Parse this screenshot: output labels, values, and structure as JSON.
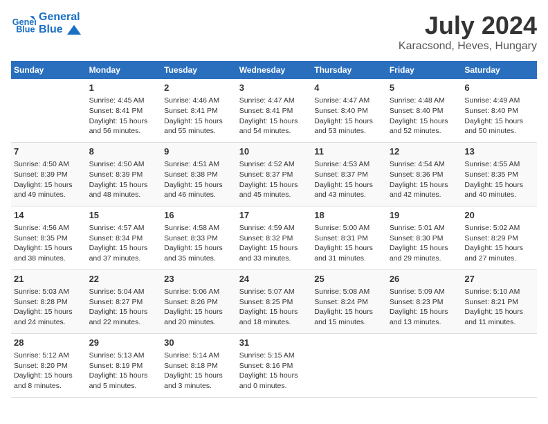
{
  "logo": {
    "line1": "General",
    "line2": "Blue"
  },
  "title": "July 2024",
  "subtitle": "Karacsond, Heves, Hungary",
  "headers": [
    "Sunday",
    "Monday",
    "Tuesday",
    "Wednesday",
    "Thursday",
    "Friday",
    "Saturday"
  ],
  "weeks": [
    [
      {
        "day": "",
        "content": ""
      },
      {
        "day": "1",
        "content": "Sunrise: 4:45 AM\nSunset: 8:41 PM\nDaylight: 15 hours\nand 56 minutes."
      },
      {
        "day": "2",
        "content": "Sunrise: 4:46 AM\nSunset: 8:41 PM\nDaylight: 15 hours\nand 55 minutes."
      },
      {
        "day": "3",
        "content": "Sunrise: 4:47 AM\nSunset: 8:41 PM\nDaylight: 15 hours\nand 54 minutes."
      },
      {
        "day": "4",
        "content": "Sunrise: 4:47 AM\nSunset: 8:40 PM\nDaylight: 15 hours\nand 53 minutes."
      },
      {
        "day": "5",
        "content": "Sunrise: 4:48 AM\nSunset: 8:40 PM\nDaylight: 15 hours\nand 52 minutes."
      },
      {
        "day": "6",
        "content": "Sunrise: 4:49 AM\nSunset: 8:40 PM\nDaylight: 15 hours\nand 50 minutes."
      }
    ],
    [
      {
        "day": "7",
        "content": "Sunrise: 4:50 AM\nSunset: 8:39 PM\nDaylight: 15 hours\nand 49 minutes."
      },
      {
        "day": "8",
        "content": "Sunrise: 4:50 AM\nSunset: 8:39 PM\nDaylight: 15 hours\nand 48 minutes."
      },
      {
        "day": "9",
        "content": "Sunrise: 4:51 AM\nSunset: 8:38 PM\nDaylight: 15 hours\nand 46 minutes."
      },
      {
        "day": "10",
        "content": "Sunrise: 4:52 AM\nSunset: 8:37 PM\nDaylight: 15 hours\nand 45 minutes."
      },
      {
        "day": "11",
        "content": "Sunrise: 4:53 AM\nSunset: 8:37 PM\nDaylight: 15 hours\nand 43 minutes."
      },
      {
        "day": "12",
        "content": "Sunrise: 4:54 AM\nSunset: 8:36 PM\nDaylight: 15 hours\nand 42 minutes."
      },
      {
        "day": "13",
        "content": "Sunrise: 4:55 AM\nSunset: 8:35 PM\nDaylight: 15 hours\nand 40 minutes."
      }
    ],
    [
      {
        "day": "14",
        "content": "Sunrise: 4:56 AM\nSunset: 8:35 PM\nDaylight: 15 hours\nand 38 minutes."
      },
      {
        "day": "15",
        "content": "Sunrise: 4:57 AM\nSunset: 8:34 PM\nDaylight: 15 hours\nand 37 minutes."
      },
      {
        "day": "16",
        "content": "Sunrise: 4:58 AM\nSunset: 8:33 PM\nDaylight: 15 hours\nand 35 minutes."
      },
      {
        "day": "17",
        "content": "Sunrise: 4:59 AM\nSunset: 8:32 PM\nDaylight: 15 hours\nand 33 minutes."
      },
      {
        "day": "18",
        "content": "Sunrise: 5:00 AM\nSunset: 8:31 PM\nDaylight: 15 hours\nand 31 minutes."
      },
      {
        "day": "19",
        "content": "Sunrise: 5:01 AM\nSunset: 8:30 PM\nDaylight: 15 hours\nand 29 minutes."
      },
      {
        "day": "20",
        "content": "Sunrise: 5:02 AM\nSunset: 8:29 PM\nDaylight: 15 hours\nand 27 minutes."
      }
    ],
    [
      {
        "day": "21",
        "content": "Sunrise: 5:03 AM\nSunset: 8:28 PM\nDaylight: 15 hours\nand 24 minutes."
      },
      {
        "day": "22",
        "content": "Sunrise: 5:04 AM\nSunset: 8:27 PM\nDaylight: 15 hours\nand 22 minutes."
      },
      {
        "day": "23",
        "content": "Sunrise: 5:06 AM\nSunset: 8:26 PM\nDaylight: 15 hours\nand 20 minutes."
      },
      {
        "day": "24",
        "content": "Sunrise: 5:07 AM\nSunset: 8:25 PM\nDaylight: 15 hours\nand 18 minutes."
      },
      {
        "day": "25",
        "content": "Sunrise: 5:08 AM\nSunset: 8:24 PM\nDaylight: 15 hours\nand 15 minutes."
      },
      {
        "day": "26",
        "content": "Sunrise: 5:09 AM\nSunset: 8:23 PM\nDaylight: 15 hours\nand 13 minutes."
      },
      {
        "day": "27",
        "content": "Sunrise: 5:10 AM\nSunset: 8:21 PM\nDaylight: 15 hours\nand 11 minutes."
      }
    ],
    [
      {
        "day": "28",
        "content": "Sunrise: 5:12 AM\nSunset: 8:20 PM\nDaylight: 15 hours\nand 8 minutes."
      },
      {
        "day": "29",
        "content": "Sunrise: 5:13 AM\nSunset: 8:19 PM\nDaylight: 15 hours\nand 5 minutes."
      },
      {
        "day": "30",
        "content": "Sunrise: 5:14 AM\nSunset: 8:18 PM\nDaylight: 15 hours\nand 3 minutes."
      },
      {
        "day": "31",
        "content": "Sunrise: 5:15 AM\nSunset: 8:16 PM\nDaylight: 15 hours\nand 0 minutes."
      },
      {
        "day": "",
        "content": ""
      },
      {
        "day": "",
        "content": ""
      },
      {
        "day": "",
        "content": ""
      }
    ]
  ]
}
